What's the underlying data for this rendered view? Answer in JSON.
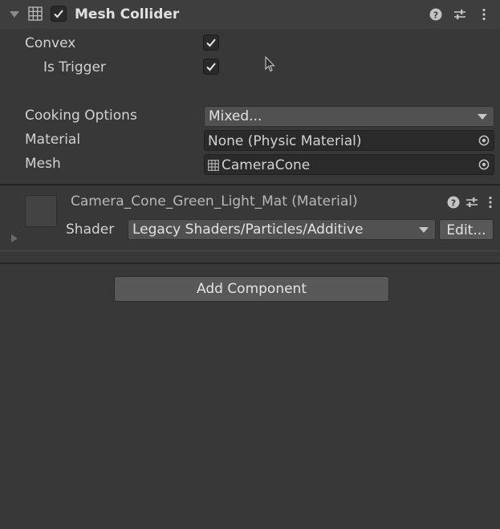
{
  "mesh_collider": {
    "title": "Mesh Collider",
    "enabled": true,
    "icons": [
      "foldout-arrow-icon",
      "mesh-grid-icon",
      "help-icon",
      "preset-sliders-icon",
      "context-menu-icon"
    ],
    "convex": {
      "label": "Convex",
      "checked": true
    },
    "is_trigger": {
      "label": "Is Trigger",
      "checked": true
    },
    "cooking_options": {
      "label": "Cooking Options",
      "value": "Mixed..."
    },
    "material": {
      "label": "Material",
      "value": "None (Physic Material)"
    },
    "mesh": {
      "label": "Mesh",
      "value": "CameraCone"
    }
  },
  "material_section": {
    "title": "Camera_Cone_Green_Light_Mat (Material)",
    "shader_label": "Shader",
    "shader_value": "Legacy Shaders/Particles/Additive",
    "edit_label": "Edit..."
  },
  "add_component": {
    "label": "Add Component"
  },
  "colors": {
    "panel_bg": "#383838",
    "header_bg": "#3e3e3e",
    "field_bg": "#2a2a2a",
    "button_bg": "#585858",
    "text": "#d2d2d2"
  }
}
